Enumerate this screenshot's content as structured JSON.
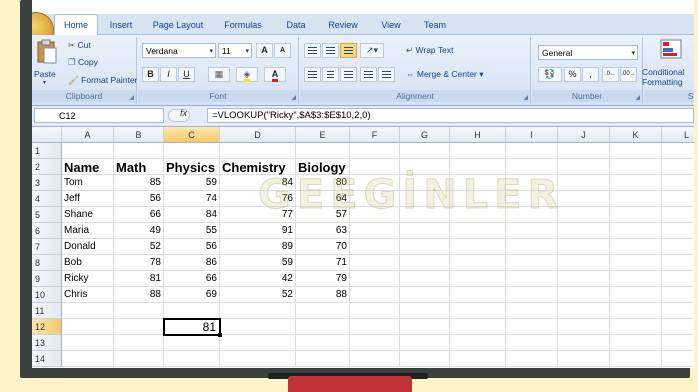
{
  "tabs": [
    "Home",
    "Insert",
    "Page Layout",
    "Formulas",
    "Data",
    "Review",
    "View",
    "Team"
  ],
  "active_tab": "Home",
  "clipboard": {
    "group_label": "Clipboard",
    "paste": "Paste",
    "cut": "Cut",
    "copy": "Copy",
    "format_painter": "Format Painter"
  },
  "font": {
    "group_label": "Font",
    "font_name": "Verdana",
    "font_size": "11",
    "grow": "A",
    "shrink": "A",
    "bold": "B",
    "italic": "I",
    "underline": "U",
    "font_color_glyph": "A"
  },
  "alignment": {
    "group_label": "Alignment",
    "wrap_text": "Wrap Text",
    "merge_center": "Merge & Center"
  },
  "number": {
    "group_label": "Number",
    "format": "General",
    "percent": "%",
    "comma": ","
  },
  "styles": {
    "conditional": "Conditional",
    "formatting": "Formatting",
    "group_label_partial": "Sty"
  },
  "formula_bar": {
    "name_box": "C12",
    "fx": "fx",
    "formula": "=VLOOKUP(\"Ricky\",$A$3:$E$10,2,0)"
  },
  "columns": [
    "A",
    "B",
    "C",
    "D",
    "E",
    "F",
    "G",
    "H",
    "I",
    "J",
    "K",
    "L"
  ],
  "selected_column": "C",
  "selected_row": "12",
  "rows": [
    "1",
    "2",
    "3",
    "4",
    "5",
    "6",
    "7",
    "8",
    "9",
    "10",
    "11",
    "12",
    "13",
    "14"
  ],
  "table": {
    "headers": [
      "Name",
      "Math",
      "Physics",
      "Chemistry",
      "Biology"
    ],
    "records": [
      [
        "Tom",
        "85",
        "59",
        "84",
        "80"
      ],
      [
        "Jeff",
        "56",
        "74",
        "76",
        "64"
      ],
      [
        "Shane",
        "66",
        "84",
        "77",
        "57"
      ],
      [
        "Maria",
        "49",
        "55",
        "91",
        "63"
      ],
      [
        "Donald",
        "52",
        "56",
        "89",
        "70"
      ],
      [
        "Bob",
        "78",
        "86",
        "59",
        "71"
      ],
      [
        "Ricky",
        "81",
        "66",
        "42",
        "79"
      ],
      [
        "Chris",
        "88",
        "69",
        "52",
        "88"
      ]
    ]
  },
  "result_cell": "81",
  "watermark": "GEEGİNLER"
}
